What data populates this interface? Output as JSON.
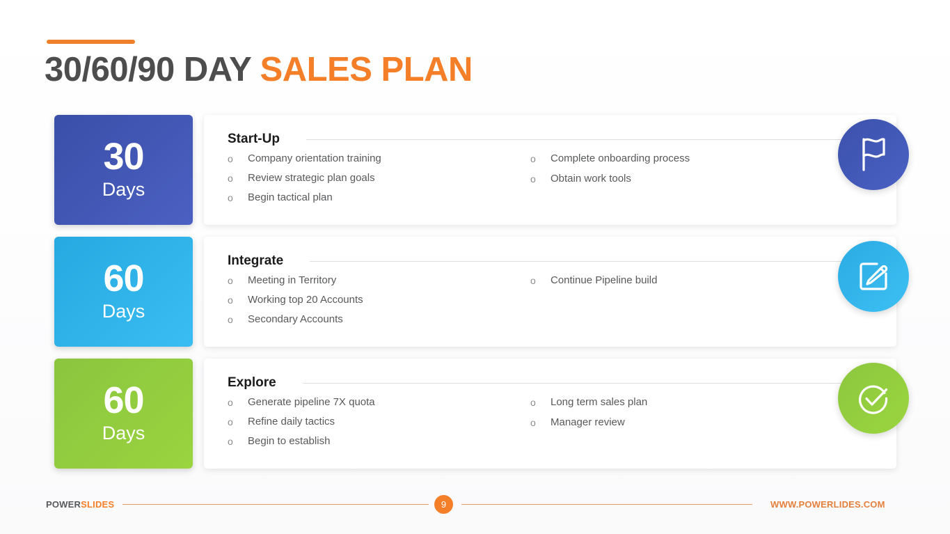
{
  "slide": {
    "title_dark": "30/60/90 DAY ",
    "title_orange": "SALES PLAN",
    "accent_color": "#ef7f2b"
  },
  "rows": [
    {
      "badge": {
        "number": "30",
        "unit": "Days",
        "color_from": "#3a4fa8",
        "color_to": "#4b60c2"
      },
      "title": "Start-Up",
      "icon": "flag-icon",
      "icon_color_from": "#3b51ab",
      "icon_color_to": "#4b61c4",
      "left_items": [
        "Company orientation training",
        "Review strategic plan goals",
        "Begin tactical plan"
      ],
      "right_items": [
        "Complete onboarding process",
        "Obtain work tools"
      ]
    },
    {
      "badge": {
        "number": "60",
        "unit": "Days",
        "color_from": "#26a9e0",
        "color_to": "#39bdf2"
      },
      "title": "Integrate",
      "icon": "edit-pencil-icon",
      "icon_color_from": "#2aabe2",
      "icon_color_to": "#3dc0f4",
      "left_items": [
        "Meeting in Territory",
        "Working top 20 Accounts",
        "Secondary Accounts"
      ],
      "right_items": [
        "Continue Pipeline build"
      ]
    },
    {
      "badge": {
        "number": "60",
        "unit": "Days",
        "color_from": "#8bc53f",
        "color_to": "#9ad43f"
      },
      "title": "Explore",
      "icon": "check-circle-icon",
      "icon_color_from": "#8cc63f",
      "icon_color_to": "#9bd63f",
      "left_items": [
        "Generate pipeline 7X quota",
        "Refine daily tactics",
        "Begin to establish"
      ],
      "right_items": [
        "Long term sales plan",
        "Manager review"
      ]
    }
  ],
  "bullet_glyph": "o",
  "footer": {
    "brand_dark": "POWER",
    "brand_orange": "SLIDES",
    "page_number": "9",
    "website": "WWW.POWERLIDES.COM"
  }
}
